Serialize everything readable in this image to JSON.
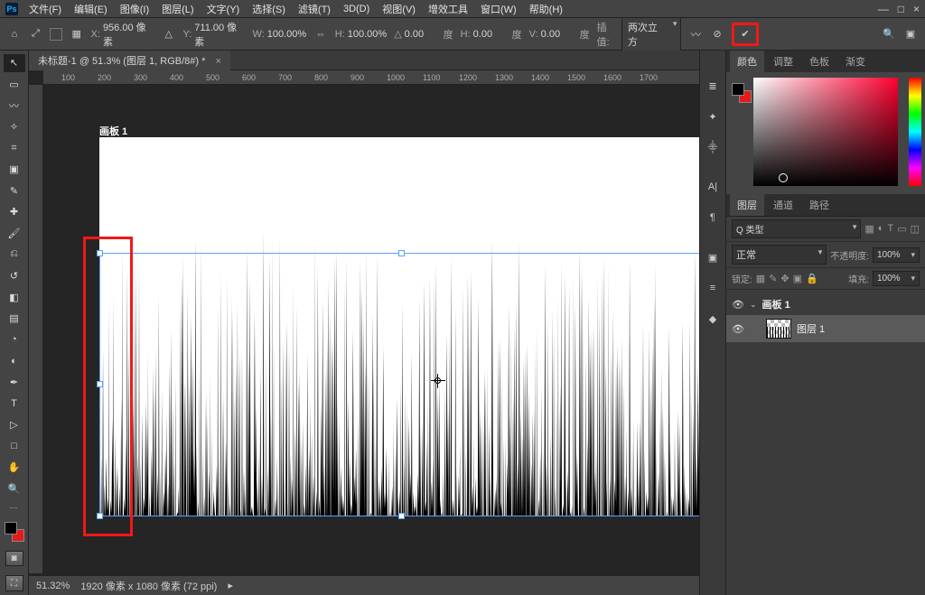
{
  "menu": {
    "file": "文件(F)",
    "edit": "编辑(E)",
    "image": "图像(I)",
    "layer": "图层(L)",
    "type": "文字(Y)",
    "select": "选择(S)",
    "filter": "滤镜(T)",
    "t3d": "3D(D)",
    "view": "视图(V)",
    "plugins": "增效工具",
    "window": "窗口(W)",
    "help": "帮助(H)"
  },
  "window": {
    "minimize": "—",
    "maximize": "□",
    "close": "×",
    "ps": "Ps"
  },
  "options": {
    "x_label": "X:",
    "x_val": "956.00 像素",
    "y_label": "Y:",
    "y_val": "711.00 像素",
    "w_label": "W:",
    "w_val": "100.00%",
    "h_label": "H:",
    "h_val": "100.00%",
    "angle_label": "△",
    "angle_val": "0.00",
    "angle_unit": "度",
    "hskew_label": "H:",
    "hskew_val": "0.00",
    "hskew_unit": "度",
    "vskew_label": "V:",
    "vskew_val": "0.00",
    "vskew_unit": "度",
    "interp_label": "插值:",
    "interp_val": "两次立方"
  },
  "document": {
    "tab": "未标题-1 @ 51.3% (图层 1, RGB/8#) *",
    "artboard_label": "画板 1"
  },
  "ruler_marks": [
    "100",
    "200",
    "300",
    "400",
    "500",
    "600",
    "700",
    "800",
    "900",
    "1000",
    "1100",
    "1200",
    "1300",
    "1400",
    "1500",
    "1600",
    "1700"
  ],
  "status": {
    "zoom": "51.32%",
    "info": "1920 像素 x 1080 像素 (72 ppi)"
  },
  "panels": {
    "color_tabs": {
      "color": "颜色",
      "adjust": "调整",
      "swatches": "色板",
      "gradient": "渐变"
    },
    "layer_tabs": {
      "layers": "图层",
      "channels": "通道",
      "paths": "路径"
    },
    "layers": {
      "type_label": "类型",
      "type_value": "Q 类型",
      "blend": "正常",
      "opacity_label": "不透明度:",
      "opacity_value": "100%",
      "lock_label": "锁定:",
      "fill_label": "填充:",
      "fill_value": "100%",
      "artboard": "画板 1",
      "layer1": "图层 1"
    }
  },
  "tools": [
    "move",
    "rect-marquee",
    "lasso",
    "magic-wand",
    "crop",
    "frame",
    "eyedropper",
    "spot-heal",
    "brush",
    "clone",
    "history-brush",
    "eraser",
    "gradient",
    "blur",
    "dodge",
    "pen",
    "type",
    "path-select",
    "rectangle",
    "hand",
    "zoom"
  ]
}
